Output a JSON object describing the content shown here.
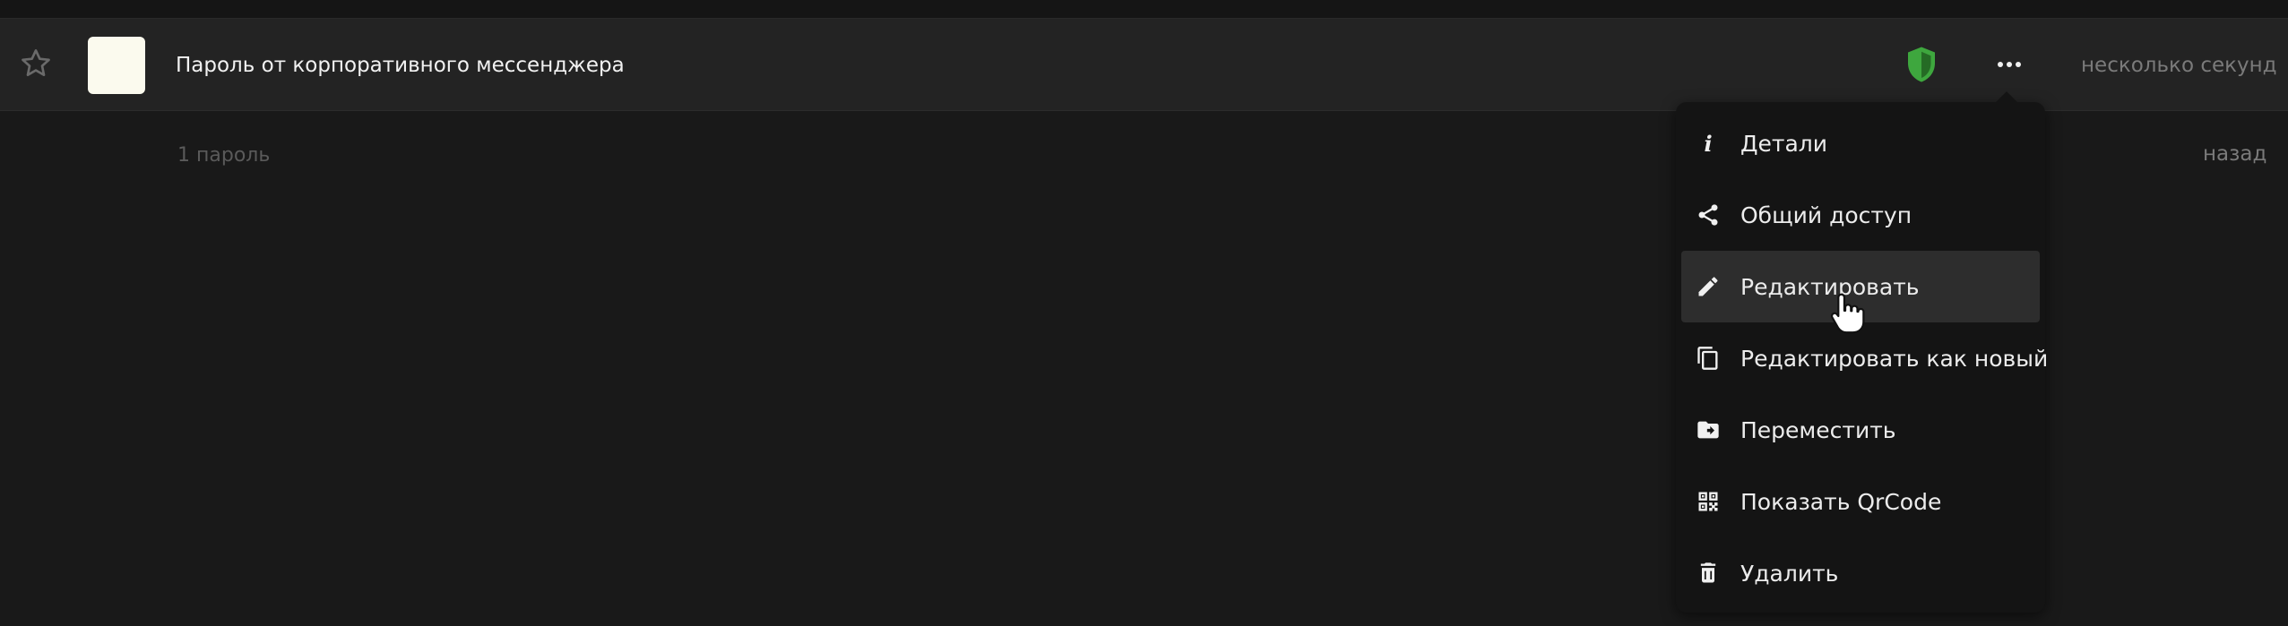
{
  "list": {
    "entry": {
      "title": "Пароль от корпоративного мессенджера",
      "modified": "несколько секунд",
      "modified_suffix": "назад",
      "favorite_icon": "star-outline-icon",
      "security_icon": "shield-icon",
      "security_color": "#3ea73e",
      "menu_icon": "more-horizontal-icon"
    },
    "count_label": "1 пароль"
  },
  "context_menu": {
    "items": [
      {
        "label": "Детали",
        "icon": "info-icon"
      },
      {
        "label": "Общий доступ",
        "icon": "share-icon"
      },
      {
        "label": "Редактировать",
        "icon": "pencil-icon"
      },
      {
        "label": "Редактировать как новый",
        "icon": "copy-icon"
      },
      {
        "label": "Переместить",
        "icon": "folder-move-icon"
      },
      {
        "label": "Показать QrCode",
        "icon": "qrcode-icon"
      },
      {
        "label": "Удалить",
        "icon": "trash-icon"
      }
    ],
    "highlighted_item": "Редактировать"
  },
  "colors": {
    "background": "#191919",
    "row_background": "#232323",
    "menu_background": "#141414",
    "menu_hover": "#2d2d2d"
  }
}
